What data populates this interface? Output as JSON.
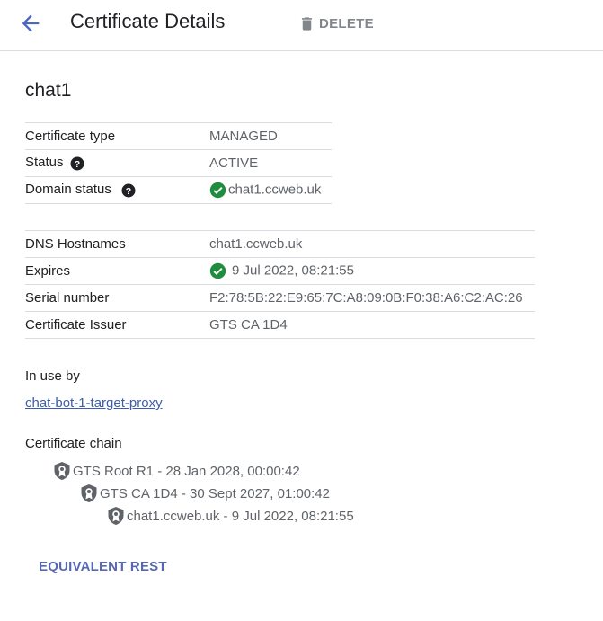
{
  "header": {
    "title": "Certificate Details",
    "delete_label": "DELETE"
  },
  "certificate": {
    "name": "chat1",
    "basic": [
      {
        "label": "Certificate type",
        "value": "MANAGED"
      },
      {
        "label": "Status",
        "value": "ACTIVE"
      },
      {
        "label": "Domain status",
        "value": "chat1.ccweb.uk"
      }
    ],
    "details": [
      {
        "label": "DNS Hostnames",
        "value": "chat1.ccweb.uk"
      },
      {
        "label": "Expires",
        "value": "9 Jul 2022, 08:21:55"
      },
      {
        "label": "Serial number",
        "value": "F2:78:5B:22:E9:65:7C:A8:09:0B:F0:38:A6:C2:AC:26"
      },
      {
        "label": "Certificate Issuer",
        "value": "GTS CA 1D4"
      }
    ]
  },
  "in_use": {
    "title": "In use by",
    "link": "chat-bot-1-target-proxy"
  },
  "chain": {
    "title": "Certificate chain",
    "items": [
      "GTS Root R1 - 28 Jan 2028, 00:00:42",
      "GTS CA 1D4 - 30 Sept 2027, 01:00:42",
      "chat1.ccweb.uk - 9 Jul 2022, 08:21:55"
    ]
  },
  "footer": {
    "rest_label": "EQUIVALENT REST"
  },
  "colors": {
    "accent": "#3c5cae",
    "success": "#1e8e3e",
    "muted": "#5f6368"
  }
}
